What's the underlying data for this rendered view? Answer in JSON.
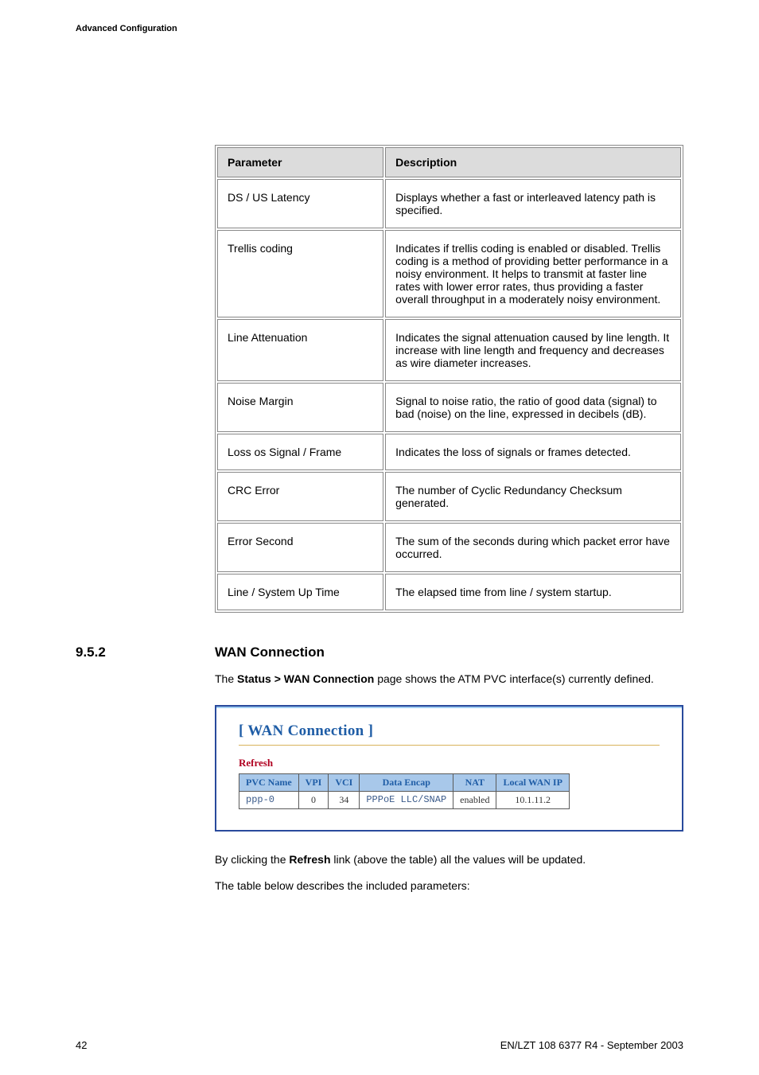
{
  "header": "Advanced Configuration",
  "param_table": {
    "headers": [
      "Parameter",
      "Description"
    ],
    "rows": [
      {
        "param": "DS / US Latency",
        "desc": "Displays whether a fast or interleaved latency path is specified."
      },
      {
        "param": "Trellis coding",
        "desc": "Indicates if trellis coding is enabled or disabled. Trellis coding is a method of providing better performance in a noisy environment. It helps to transmit at faster line rates with lower error rates, thus providing a faster overall throughput in a moderately noisy environment."
      },
      {
        "param": "Line Attenuation",
        "desc": "Indicates the signal attenuation caused by line length. It increase with line length and frequency and decreases as wire diameter increases."
      },
      {
        "param": "Noise Margin",
        "desc": "Signal to noise ratio, the ratio of good data (signal) to bad (noise) on the line, expressed in decibels (dB)."
      },
      {
        "param": "Loss os Signal / Frame",
        "desc": "Indicates the loss of signals or frames detected."
      },
      {
        "param": "CRC Error",
        "desc": "The number of Cyclic Redundancy Checksum generated."
      },
      {
        "param": "Error Second",
        "desc": "The sum of the seconds during which packet error have occurred."
      },
      {
        "param": "Line / System Up Time",
        "desc": "The elapsed time from line / system startup."
      }
    ]
  },
  "section": {
    "number": "9.5.2",
    "title": "WAN Connection"
  },
  "intro": {
    "prefix": "The ",
    "bold": "Status > WAN Connection",
    "suffix": " page shows the ATM PVC interface(s) currently defined."
  },
  "wan_panel": {
    "heading": "[ WAN Connection ]",
    "refresh": "Refresh",
    "headers": [
      "PVC Name",
      "VPI",
      "VCI",
      "Data Encap",
      "NAT",
      "Local WAN IP"
    ],
    "row": {
      "pvc": "ppp-0",
      "vpi": "0",
      "vci": "34",
      "encap": "PPPoE LLC/SNAP",
      "nat": "enabled",
      "ip": "10.1.11.2"
    }
  },
  "after_panel": {
    "p1_prefix": "By clicking the ",
    "p1_bold": "Refresh",
    "p1_suffix": " link (above the table) all the values will be updated.",
    "p2": "The table below describes the included parameters:"
  },
  "footer": {
    "page": "42",
    "docid": "EN/LZT 108 6377 R4 - September 2003"
  }
}
